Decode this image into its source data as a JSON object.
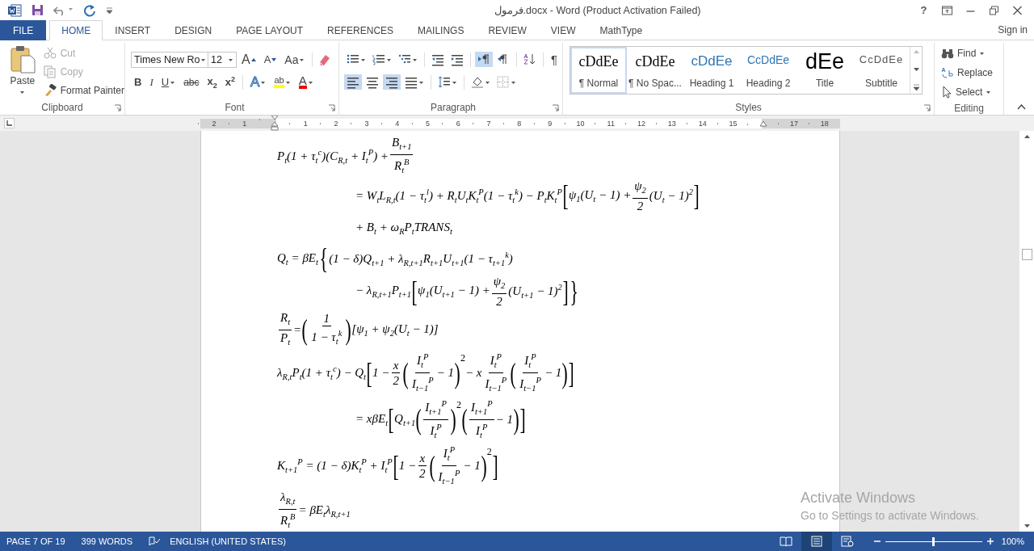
{
  "title_bar": {
    "title": "فرمول.docx - Word (Product Activation Failed)",
    "help": "?"
  },
  "tabs": [
    {
      "label": "FILE",
      "kind": "file",
      "selected": false
    },
    {
      "label": "HOME",
      "kind": "tab",
      "selected": true
    },
    {
      "label": "INSERT",
      "kind": "tab",
      "selected": false
    },
    {
      "label": "DESIGN",
      "kind": "tab",
      "selected": false
    },
    {
      "label": "PAGE LAYOUT",
      "kind": "tab",
      "selected": false
    },
    {
      "label": "REFERENCES",
      "kind": "tab",
      "selected": false
    },
    {
      "label": "MAILINGS",
      "kind": "tab",
      "selected": false
    },
    {
      "label": "REVIEW",
      "kind": "tab",
      "selected": false
    },
    {
      "label": "VIEW",
      "kind": "tab",
      "selected": false
    },
    {
      "label": "MathType",
      "kind": "tab",
      "selected": false
    }
  ],
  "sign_in": "Sign in",
  "clipboard": {
    "label": "Clipboard",
    "paste": "Paste",
    "items": [
      {
        "label": "Cut",
        "disabled": true
      },
      {
        "label": "Copy",
        "disabled": true
      },
      {
        "label": "Format Painter",
        "disabled": false
      }
    ]
  },
  "font": {
    "label": "Font",
    "name": "Times New Ro",
    "size": "12",
    "buttons_top": [
      {
        "label": "A",
        "kind": "grow"
      },
      {
        "label": "A",
        "kind": "shrink"
      },
      {
        "label": "Aa",
        "kind": "case"
      }
    ],
    "buttons_bottom": [
      {
        "label": "B",
        "kind": "bold"
      },
      {
        "label": "I",
        "kind": "italic"
      },
      {
        "label": "U",
        "kind": "underline"
      },
      {
        "label": "abc",
        "kind": "strike"
      },
      {
        "label": "x$_{2}$",
        "kind": "plain"
      },
      {
        "label": "x$^{2}$",
        "kind": "plain"
      },
      {
        "label": "A",
        "kind": "effects"
      },
      {
        "label": "ab",
        "kind": "highlight"
      },
      {
        "label": "A",
        "kind": "color"
      }
    ]
  },
  "paragraph": {
    "label": "Paragraph",
    "pilcrow": "¶",
    "buttons_top": [
      {
        "selected": false
      },
      {
        "selected": false
      },
      {
        "selected": false
      },
      {
        "selected": false
      },
      {
        "selected": false
      },
      {
        "selected": true
      },
      {
        "selected": false
      },
      {
        "selected": false
      }
    ],
    "buttons_bottom": [
      {
        "selected": true
      },
      {
        "selected": false
      },
      {
        "selected": true
      },
      {
        "selected": false
      },
      {
        "selected": false
      },
      {
        "selected": false
      },
      {
        "selected": false
      }
    ]
  },
  "styles": {
    "label": "Styles",
    "items": [
      {
        "preview": "cDdEe",
        "name": "¶ Normal",
        "kind": "normal",
        "selected": true
      },
      {
        "preview": "cDdEe",
        "name": "¶ No Spac...",
        "kind": "normal",
        "selected": false
      },
      {
        "preview": "cDdEe",
        "name": "Heading 1",
        "kind": "heading1",
        "selected": false
      },
      {
        "preview": "CcDdEe",
        "name": "Heading 2",
        "kind": "heading2",
        "selected": false
      },
      {
        "preview": "dEe",
        "name": "Title",
        "kind": "title",
        "selected": false
      },
      {
        "preview": "CcDdEe",
        "name": "Subtitle",
        "kind": "subtitle",
        "selected": false
      }
    ]
  },
  "editing": {
    "label": "Editing",
    "items": [
      {
        "label": "Find"
      },
      {
        "label": "Replace"
      },
      {
        "label": "Select"
      }
    ]
  },
  "ruler": {
    "ticks": [
      "2",
      "1",
      "1",
      "2",
      "3",
      "4",
      "5",
      "6",
      "7",
      "8",
      "9",
      "10",
      "11",
      "12",
      "13",
      "14",
      "15",
      "17",
      "18"
    ]
  },
  "document": {
    "equations": [
      {
        "lines": [
          {
            "kind": "first",
            "pieces": [
              {
                "kind": "text",
                "text": "P$_{t}$(1 + τ$_{t}$$^{c}$)(C$_{R,t}$ + I$_{t}$$^{P}$) + "
              },
              {
                "kind": "frac",
                "num": "B$_{t+1}$",
                "den": "R$_{t}$$^{B}$"
              }
            ]
          },
          {
            "kind": "continuation",
            "pieces": [
              {
                "kind": "text",
                "text": "= W$_{t}$L$_{R,t}$(1 − τ$_{t}$$^{l}$) + R$_{t}$U$_{t}$K$_{t}$$^{P}$(1 − τ$_{t}$$^{k}$) − P$_{t}$K$_{t}$$^{P}$"
              },
              {
                "kind": "delim",
                "text": "["
              },
              {
                "kind": "text",
                "text": "ψ$_{1}$(U$_{t}$ − 1) + "
              },
              {
                "kind": "frac",
                "num": "ψ$_{2}$",
                "den": "2"
              },
              {
                "kind": "text",
                "text": "(U$_{t}$ − 1)$^{2}$"
              },
              {
                "kind": "delim",
                "text": "]"
              }
            ]
          },
          {
            "kind": "continuation",
            "pieces": [
              {
                "kind": "text",
                "text": "+ B$_{t}$ + ω$_{R}$P$_{t}$TRANS$_{t}$"
              }
            ]
          }
        ]
      },
      {
        "lines": [
          {
            "kind": "first",
            "pieces": [
              {
                "kind": "text",
                "text": "Q$_{t}$ = βE$_{t}$"
              },
              {
                "kind": "delim",
                "text": "{"
              },
              {
                "kind": "text",
                "text": "(1 − δ)Q$_{t+1}$ + λ$_{R,t+1}$R$_{t+1}$U$_{t+1}$(1 − τ$_{t+1}$$^{k}$)"
              }
            ]
          },
          {
            "kind": "continuation",
            "pieces": [
              {
                "kind": "text",
                "text": "− λ$_{R,t+1}$P$_{t+1}$"
              },
              {
                "kind": "delim",
                "text": "["
              },
              {
                "kind": "text",
                "text": "ψ$_{1}$(U$_{t+1}$ − 1) + "
              },
              {
                "kind": "frac",
                "num": "ψ$_{2}$",
                "den": "2"
              },
              {
                "kind": "text",
                "text": "(U$_{t+1}$ − 1)$^{2}$"
              },
              {
                "kind": "delim",
                "text": "]"
              },
              {
                "kind": "delim",
                "text": "}"
              }
            ]
          }
        ]
      },
      {
        "lines": [
          {
            "kind": "first",
            "pieces": [
              {
                "kind": "frac",
                "num": "R$_{t}$",
                "den": "P$_{t}$"
              },
              {
                "kind": "text",
                "text": " = "
              },
              {
                "kind": "delim",
                "text": "("
              },
              {
                "kind": "frac",
                "num": "1",
                "den": "1 − τ$_{t}$$^{k}$"
              },
              {
                "kind": "delim",
                "text": ")"
              },
              {
                "kind": "text",
                "text": "[ψ$_{1}$ + ψ$_{2}$(U$_{t}$ − 1)]"
              }
            ]
          }
        ]
      },
      {
        "lines": [
          {
            "kind": "first",
            "pieces": [
              {
                "kind": "text",
                "text": "λ$_{R,t}$P$_{t}$(1 + τ$_{t}$$^{c}$) − Q$_{t}$"
              },
              {
                "kind": "delim",
                "text": "["
              },
              {
                "kind": "text",
                "text": "1 − "
              },
              {
                "kind": "frac",
                "num": "x",
                "den": "2"
              },
              {
                "kind": "delim",
                "text": "("
              },
              {
                "kind": "frac",
                "num": "I$_{t}$$^{P}$",
                "den": "I$_{t−1}$$^{P}$"
              },
              {
                "kind": "text",
                "text": " − 1"
              },
              {
                "kind": "delim",
                "text": ")"
              },
              {
                "kind": "power",
                "text": "2"
              },
              {
                "kind": "text",
                "text": " − x"
              },
              {
                "kind": "frac",
                "num": "I$_{t}$$^{P}$",
                "den": "I$_{t−1}$$^{P}$"
              },
              {
                "kind": "delim",
                "text": "("
              },
              {
                "kind": "frac",
                "num": "I$_{t}$$^{P}$",
                "den": "I$_{t−1}$$^{P}$"
              },
              {
                "kind": "text",
                "text": " − 1"
              },
              {
                "kind": "delim",
                "text": ")"
              },
              {
                "kind": "delim",
                "text": "]"
              }
            ]
          },
          {
            "kind": "continuation",
            "pieces": [
              {
                "kind": "text",
                "text": "= xβE$_{t}$"
              },
              {
                "kind": "delim",
                "text": "["
              },
              {
                "kind": "text",
                "text": "Q$_{t+1}$"
              },
              {
                "kind": "delim",
                "text": "("
              },
              {
                "kind": "frac",
                "num": "I$_{t+1}$$^{P}$",
                "den": "I$_{t}$$^{P}$"
              },
              {
                "kind": "delim",
                "text": ")"
              },
              {
                "kind": "power",
                "text": "2"
              },
              {
                "kind": "delim",
                "text": "("
              },
              {
                "kind": "frac",
                "num": "I$_{t+1}$$^{P}$",
                "den": "I$_{t}$$^{P}$"
              },
              {
                "kind": "text",
                "text": " − 1"
              },
              {
                "kind": "delim",
                "text": ")"
              },
              {
                "kind": "delim",
                "text": "]"
              }
            ]
          }
        ]
      },
      {
        "lines": [
          {
            "kind": "first",
            "pieces": [
              {
                "kind": "text",
                "text": "K$_{t+1}$$^{P}$ = (1 − δ)K$_{t}$$^{P}$ + I$_{t}$$^{P}$"
              },
              {
                "kind": "delim",
                "text": "["
              },
              {
                "kind": "text",
                "text": "1 − "
              },
              {
                "kind": "frac",
                "num": "x",
                "den": "2"
              },
              {
                "kind": "delim",
                "text": "("
              },
              {
                "kind": "frac",
                "num": "I$_{t}$$^{P}$",
                "den": "I$_{t−1}$$^{P}$"
              },
              {
                "kind": "text",
                "text": " − 1"
              },
              {
                "kind": "delim",
                "text": ")"
              },
              {
                "kind": "power",
                "text": "2"
              },
              {
                "kind": "delim",
                "text": "]"
              }
            ]
          }
        ]
      },
      {
        "lines": [
          {
            "kind": "first",
            "pieces": [
              {
                "kind": "frac",
                "num": "λ$_{R,t}$",
                "den": "R$_{t}$$^{B}$"
              },
              {
                "kind": "text",
                "text": " = βE$_{t}$λ$_{R,t+1}$"
              }
            ]
          }
        ]
      }
    ]
  },
  "status_bar": {
    "page": "PAGE 7 OF 19",
    "words": "399 WORDS",
    "language": "ENGLISH (UNITED STATES)",
    "zoom": "100%",
    "zoom_slider": {
      "level": 0.5
    }
  },
  "activation_notice": {
    "title": "Activate Windows",
    "message": "Go to Settings to activate Windows."
  }
}
